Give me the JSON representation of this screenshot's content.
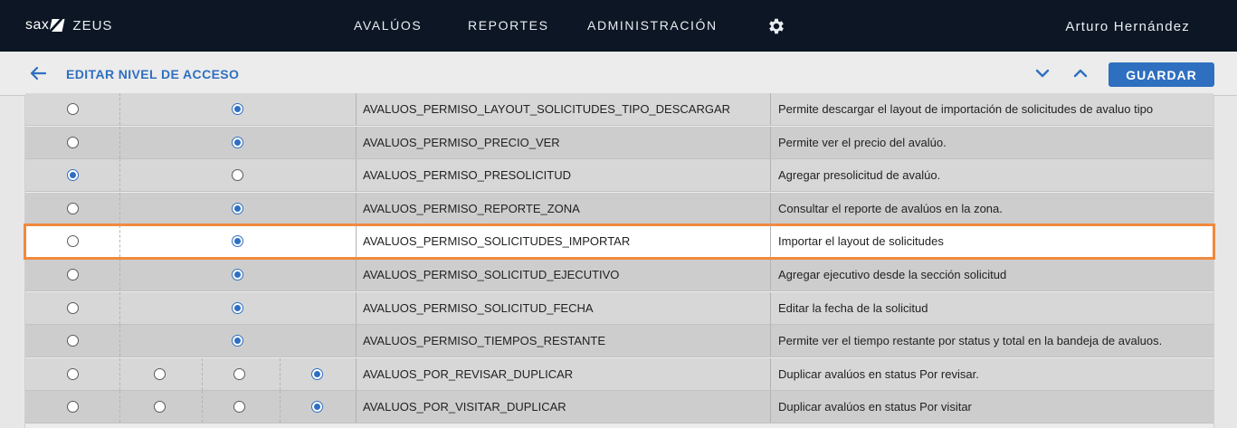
{
  "topbar": {
    "brand_logo": "sax",
    "brand_name": "ZEUS",
    "nav": [
      "AVALÚOS",
      "REPORTES",
      "ADMINISTRACIÓN"
    ],
    "user": "Arturo Hernández"
  },
  "subbar": {
    "title": "EDITAR NIVEL DE ACCESO",
    "save_label": "GUARDAR"
  },
  "rows": [
    {
      "permission": "AVALUOS_PERMISO_LAYOUT_SOLICITUDES_TIPO_DESCARGAR",
      "description": "Permite descargar el layout de importación de solicitudes de avaluo tipo",
      "radios": [
        false,
        true
      ]
    },
    {
      "permission": "AVALUOS_PERMISO_PRECIO_VER",
      "description": "Permite ver el precio del avalúo.",
      "radios": [
        false,
        true
      ]
    },
    {
      "permission": "AVALUOS_PERMISO_PRESOLICITUD",
      "description": "Agregar presolicitud de avalúo.",
      "radios": [
        true,
        false
      ]
    },
    {
      "permission": "AVALUOS_PERMISO_REPORTE_ZONA",
      "description": "Consultar el reporte de avalúos en la zona.",
      "radios": [
        false,
        true
      ]
    },
    {
      "permission": "AVALUOS_PERMISO_SOLICITUDES_IMPORTAR",
      "description": "Importar el layout de solicitudes",
      "radios": [
        false,
        true
      ],
      "highlighted": true
    },
    {
      "permission": "AVALUOS_PERMISO_SOLICITUD_EJECUTIVO",
      "description": "Agregar ejecutivo desde la sección solicitud",
      "radios": [
        false,
        true
      ]
    },
    {
      "permission": "AVALUOS_PERMISO_SOLICITUD_FECHA",
      "description": "Editar la fecha de la solicitud",
      "radios": [
        false,
        true
      ]
    },
    {
      "permission": "AVALUOS_PERMISO_TIEMPOS_RESTANTE",
      "description": "Permite ver el tiempo restante por status y total en la bandeja de avaluos.",
      "radios": [
        false,
        true
      ]
    },
    {
      "permission": "AVALUOS_POR_REVISAR_DUPLICAR",
      "description": "Duplicar avalúos en status Por revisar.",
      "radios": [
        false,
        false,
        false,
        true
      ]
    },
    {
      "permission": "AVALUOS_POR_VISITAR_DUPLICAR",
      "description": "Duplicar avalúos en status Por visitar",
      "radios": [
        false,
        false,
        false,
        true
      ]
    }
  ],
  "colors": {
    "topbar": "#0c1624",
    "accent": "#2f6fc0",
    "highlight": "#f08a3e"
  },
  "icons": {
    "gear": "gear-icon",
    "back": "arrow-left-icon",
    "down": "chevron-down-icon",
    "up": "chevron-up-icon"
  }
}
